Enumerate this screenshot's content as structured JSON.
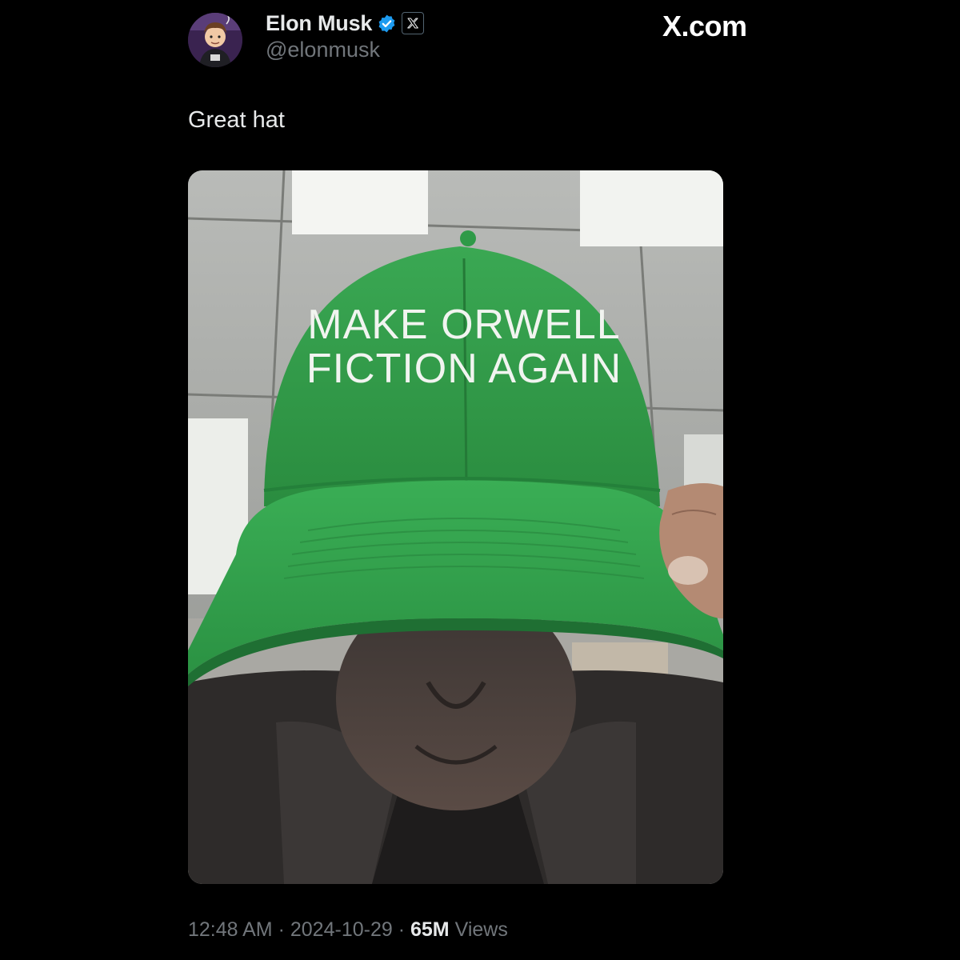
{
  "site": "X.com",
  "author": {
    "display_name": "Elon Musk",
    "handle": "@elonmusk",
    "verified": true,
    "affiliation_badge": "x-logo-icon",
    "avatar_icon": "avatar-icon"
  },
  "tweet": {
    "text": "Great hat",
    "media": {
      "hat_text_line1": "MAKE ORWELL",
      "hat_text_line2": "FICTION AGAIN",
      "hat_color": "#2e9a45"
    },
    "time": "12:48 AM",
    "date": "2024-10-29",
    "views_count": "65M",
    "views_label": "Views",
    "separator": "·"
  },
  "colors": {
    "background": "#000000",
    "text_primary": "#e7e9ea",
    "text_secondary": "#71767b",
    "verified_blue": "#1d9bf0"
  }
}
